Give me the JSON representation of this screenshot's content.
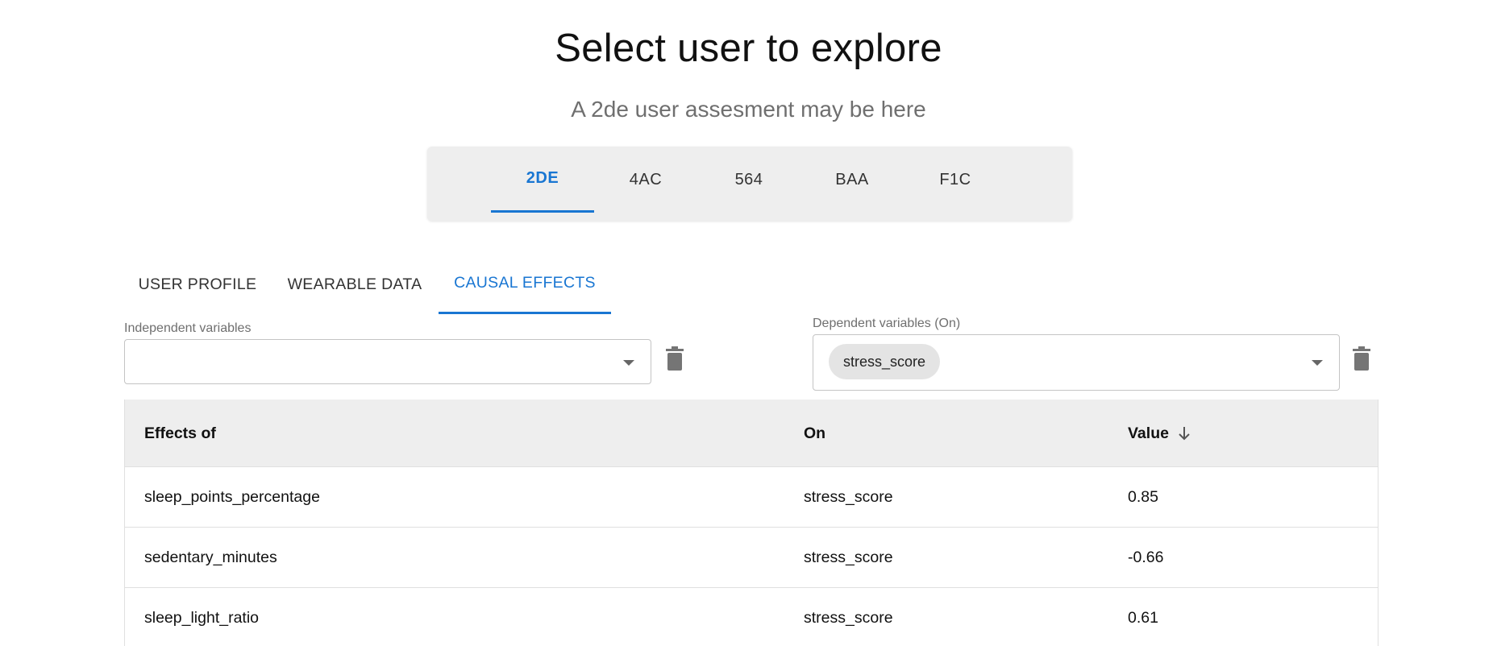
{
  "page": {
    "title": "Select user to explore",
    "subtitle": "A 2de user assesment may be here"
  },
  "user_tabs": [
    {
      "label": "2DE",
      "active": true
    },
    {
      "label": "4AC",
      "active": false
    },
    {
      "label": "564",
      "active": false
    },
    {
      "label": "BAA",
      "active": false
    },
    {
      "label": "F1C",
      "active": false
    }
  ],
  "view_tabs": [
    {
      "label": "USER PROFILE",
      "active": false
    },
    {
      "label": "WEARABLE DATA",
      "active": false
    },
    {
      "label": "CAUSAL EFFECTS",
      "active": true
    }
  ],
  "independent": {
    "label": "Independent variables",
    "selected": []
  },
  "dependent": {
    "label": "Dependent variables (On)",
    "selected": [
      "stress_score"
    ]
  },
  "table": {
    "headers": {
      "effects_of": "Effects of",
      "on": "On",
      "value": "Value"
    },
    "sort": {
      "column": "value",
      "direction": "desc"
    },
    "rows": [
      {
        "effects_of": "sleep_points_percentage",
        "on": "stress_score",
        "value": "0.85"
      },
      {
        "effects_of": "sedentary_minutes",
        "on": "stress_score",
        "value": "-0.66"
      },
      {
        "effects_of": "sleep_light_ratio",
        "on": "stress_score",
        "value": "0.61"
      }
    ]
  },
  "colors": {
    "accent": "#1976d2",
    "tab_bar_bg": "#eeeeee",
    "header_bg": "#eeeeee",
    "chip_bg": "#e4e4e4"
  },
  "icons": {
    "clear_independent": "trash-icon",
    "clear_dependent": "trash-icon",
    "dropdown": "caret-down-icon",
    "sort": "arrow-down-icon"
  }
}
